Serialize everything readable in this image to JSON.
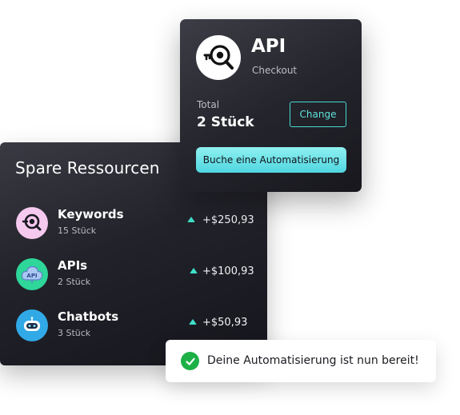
{
  "resources": {
    "title": "Spare Ressourcen",
    "items": [
      {
        "name": "Keywords",
        "count": "15 Stück",
        "value": "+$250,93",
        "icon": "keyword-search-icon",
        "icon_bg": "#f6c9ef"
      },
      {
        "name": "APIs",
        "count": "2 Stück",
        "value": "+$100,93",
        "icon": "api-cloud-icon",
        "icon_bg": "#2fd69a"
      },
      {
        "name": "Chatbots",
        "count": "3 Stück",
        "value": "+$50,93",
        "icon": "robot-icon",
        "icon_bg": "#31a9e6"
      }
    ],
    "trend_color": "#3fe0c8"
  },
  "checkout": {
    "title": "API",
    "subtitle": "Checkout",
    "logo_icon": "key-search-icon",
    "total_label": "Total",
    "total_value": "2 Stück",
    "change_label": "Change",
    "book_label": "Buche eine Automatisierung",
    "accent": "#4fd6e0"
  },
  "toast": {
    "message": "Deine Automatisierung ist nun bereit!",
    "icon": "check-circle-icon",
    "icon_color": "#1db047"
  }
}
